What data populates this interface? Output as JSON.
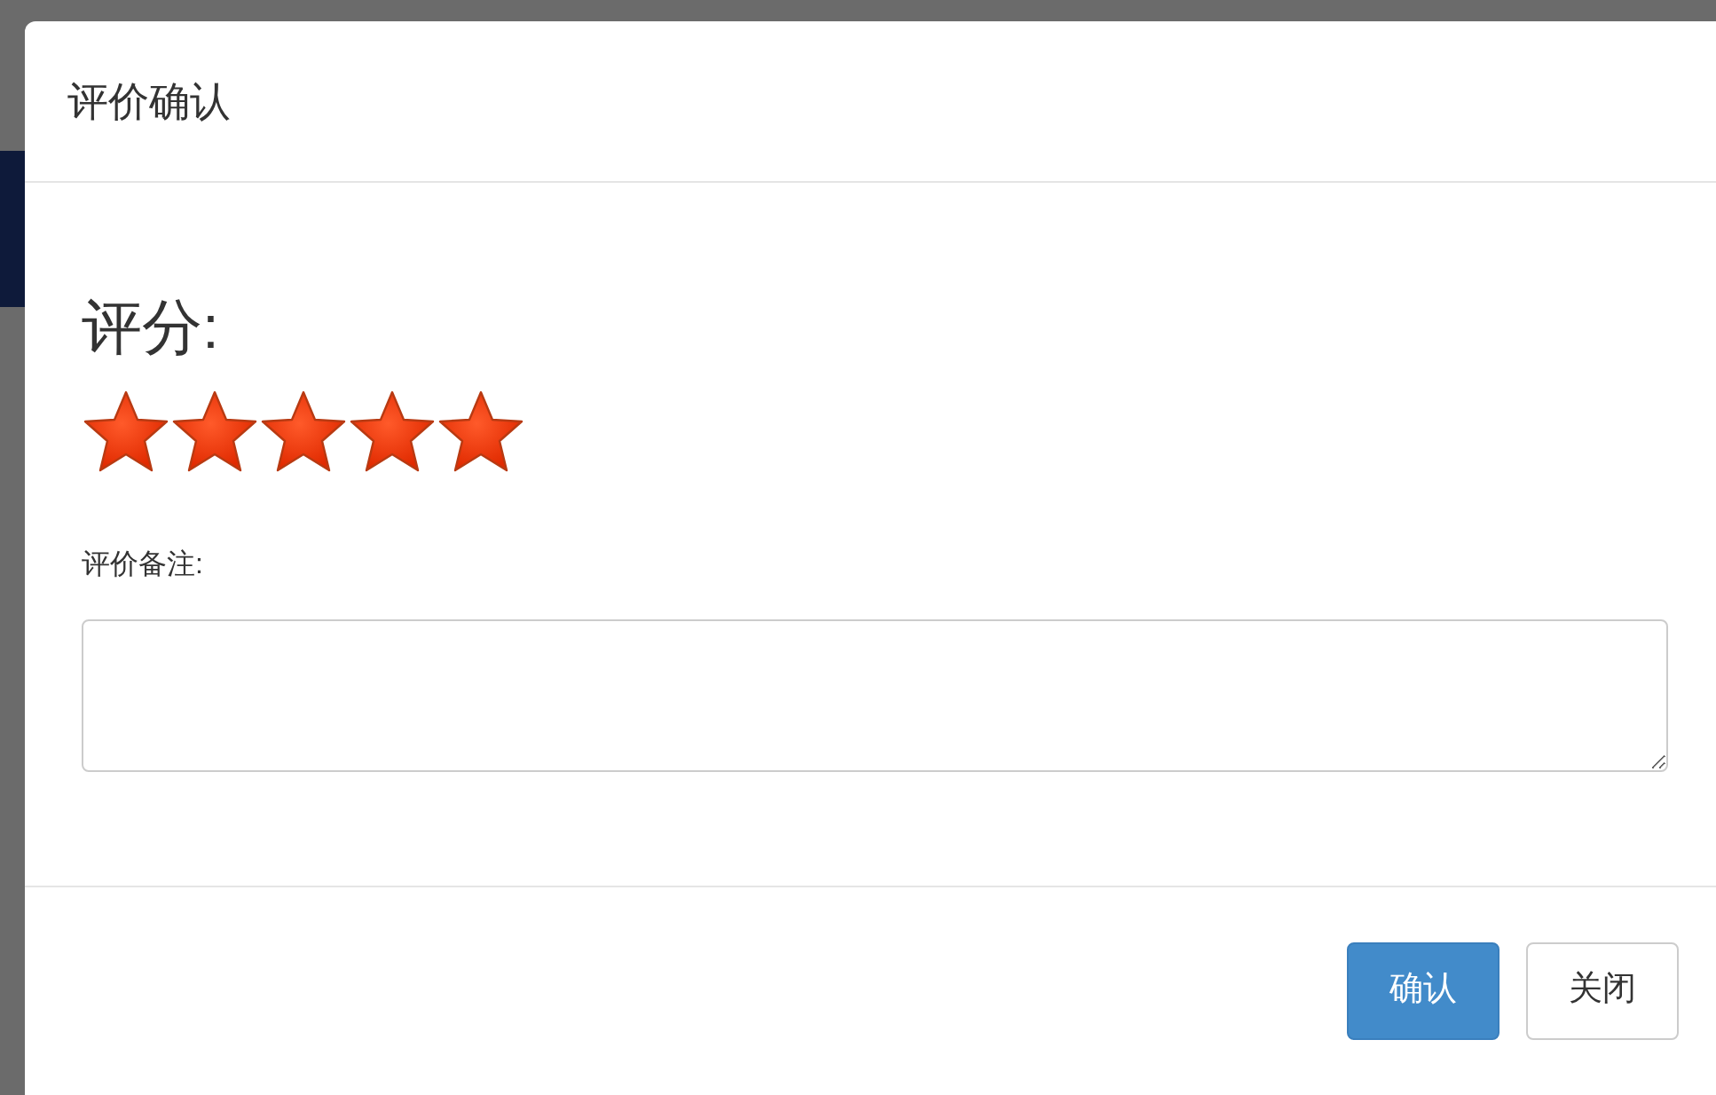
{
  "dialog": {
    "title": "评价确认"
  },
  "rating": {
    "label": "评分:",
    "stars": 5
  },
  "remark": {
    "label": "评价备注:"
  },
  "buttons": [
    {
      "label": "确认",
      "kind": "primary"
    },
    {
      "label": "关闭",
      "kind": "default"
    }
  ]
}
